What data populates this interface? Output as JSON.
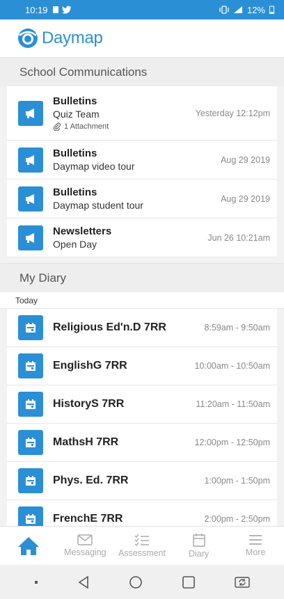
{
  "status_bar": {
    "time": "10:19",
    "battery": "12%"
  },
  "app": {
    "logo_text": "Daymap",
    "brand_color": "#2b8fd6"
  },
  "communications": {
    "header": "School Communications",
    "items": [
      {
        "title": "Bulletins",
        "subtitle": "Quiz Team",
        "attachment": "1 Attachment",
        "time": "Yesterday 12:12pm",
        "icon": "megaphone-icon"
      },
      {
        "title": "Bulletins",
        "subtitle": "Daymap video tour",
        "time": "Aug 29 2019",
        "icon": "megaphone-icon"
      },
      {
        "title": "Bulletins",
        "subtitle": "Daymap student tour",
        "time": "Aug 29 2019",
        "icon": "megaphone-icon"
      },
      {
        "title": "Newsletters",
        "subtitle": "Open Day",
        "time": "Jun 26 10:21am",
        "icon": "megaphone-icon"
      }
    ]
  },
  "diary": {
    "header": "My Diary",
    "day_label": "Today",
    "items": [
      {
        "title": "Religious Ed'n.D 7RR",
        "time": "8:59am - 9:50am",
        "icon": "calendar-icon"
      },
      {
        "title": "EnglishG 7RR",
        "time": "10:00am - 10:50am",
        "icon": "calendar-icon"
      },
      {
        "title": "HistoryS 7RR",
        "time": "11:20am - 11:50am",
        "icon": "calendar-icon"
      },
      {
        "title": "MathsH 7RR",
        "time": "12:00pm - 12:50pm",
        "icon": "calendar-icon"
      },
      {
        "title": "Phys. Ed. 7RR",
        "time": "1:00pm - 1:50pm",
        "icon": "calendar-icon"
      },
      {
        "title": "FrenchE 7RR",
        "time": "2:00pm - 2:50pm",
        "icon": "calendar-icon"
      }
    ]
  },
  "bottom_nav": {
    "items": [
      {
        "label": "",
        "icon": "home-icon",
        "active": true
      },
      {
        "label": "Messaging",
        "icon": "envelope-icon"
      },
      {
        "label": "Assessment",
        "icon": "checklist-icon"
      },
      {
        "label": "Diary",
        "icon": "calendar-icon"
      },
      {
        "label": "More",
        "icon": "menu-icon"
      }
    ]
  }
}
